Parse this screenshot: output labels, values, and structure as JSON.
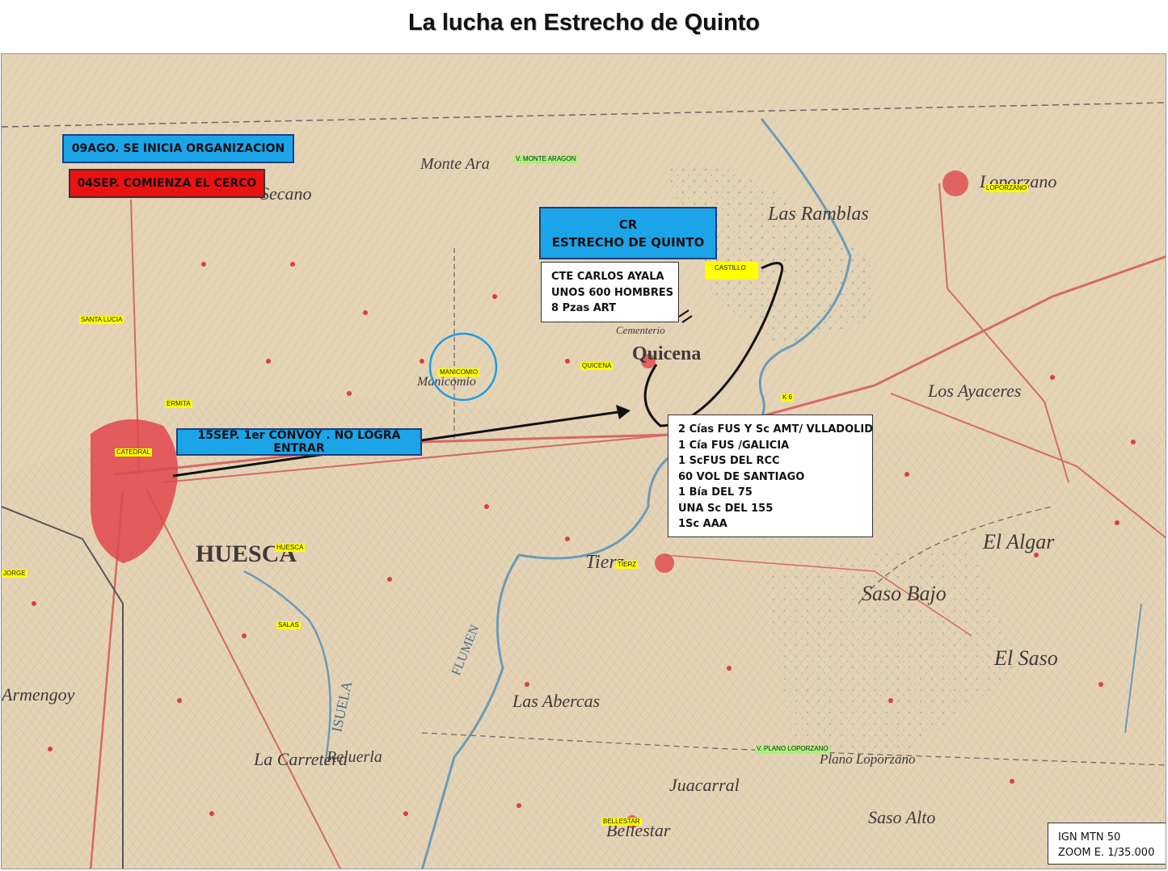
{
  "title": "La lucha en Estrecho de Quinto",
  "map_labels": {
    "monte_aragon": "Monte Ara",
    "secano": "Secano",
    "las_ramblas": "Las Ramblas",
    "loporzano": "Loporzano",
    "quicena": "Quicena",
    "huesca": "HUESCA",
    "tierz": "Tierz",
    "el_algar": "El Algar",
    "saso_bajo": "Saso Bajo",
    "el_saso": "El Saso",
    "las_abercas": "Las Abercas",
    "la_carretera": "La Carretera",
    "reluerla": "Reluerla",
    "juacarral": "Juacarral",
    "plano_loporzano": "Plano Loporzano",
    "bellestar": "Bellestar",
    "saso_alto": "Saso Alto",
    "los_ayaceres": "Los Ayaceres",
    "armengoy": "Armengoy",
    "manicomio": "Manicomio",
    "isuela": "ISUELA",
    "flumen": "FLUMEN",
    "cementerio": "Cementerio"
  },
  "place_tags": {
    "v_monte_aragon": "V. MONTE ARAGON",
    "loporzano": "LOPORZANO",
    "castillo": "CASTILLO",
    "santa_lucia": "SANTA LUCIA",
    "manicomio": "MANICOMIO",
    "quicena": "QUICENA",
    "ermita": "ERMITA",
    "k6": "K 6",
    "catedral": "CATEDRAL",
    "huesca": "HUESCA",
    "tierz": "TIERZ",
    "jorge": "JORGE",
    "salas": "SALAS",
    "v_plano_loporzano": "V. PLANO LOPORZANO",
    "bellestar": "BELLESTAR"
  },
  "timeline": {
    "organizacion": "09AGO. SE INICIA ORGANIZACION",
    "cerco": "04SEP. COMIENZA EL CERCO",
    "convoy": "15SEP. 1er CONVOY . NO LOGRA ENTRAR"
  },
  "cr_box": {
    "line1": "CR",
    "line2": "ESTRECHO DE QUINTO"
  },
  "garrison": [
    "CTE CARLOS AYALA",
    "UNOS 600 HOMBRES",
    "8 Pzas ART"
  ],
  "besieging_forces": [
    "2 Cías FUS  Y Sc AMT/ VLLADOLID",
    "1 Cía FUS /GALICIA",
    "1 ScFUS DEL RCC",
    "60 VOL DE SANTIAGO",
    "1 Bía DEL 75",
    "UNA Sc DEL 155",
    "1Sc AAA"
  ],
  "scale": {
    "source": "IGN MTN 50",
    "zoom": "ZOOM E. 1/35.000"
  },
  "colors": {
    "paper": "#e5d3b6",
    "blue_box": "#1ca4e8",
    "red_box": "#ee1111",
    "town_red": "#e0474b",
    "tag_yellow": "#ffff00",
    "tag_green": "#a8f07a",
    "water_blue": "#6a9bb8"
  }
}
